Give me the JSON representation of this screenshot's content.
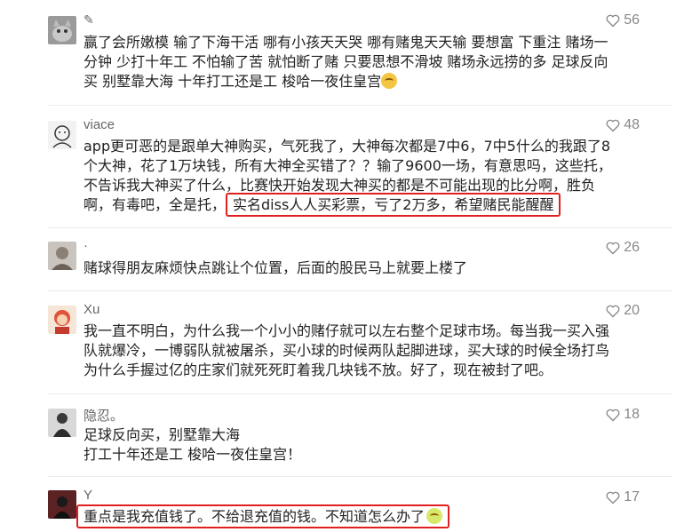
{
  "colors": {
    "highlight": "#e02020",
    "meta_text": "#888888",
    "body_text": "#222222"
  },
  "comments": [
    {
      "name": "",
      "likes": "56",
      "lines": [
        "赢了会所嫩模 输了下海干活 哪有小孩天天哭 哪有赌鬼天天输 要想富 下重注 赌场一",
        "分钟 少打十年工 不怕输了苦 就怕断了赌 只要思想不滑坡 赌场永远捞的多 足球反向",
        "买 别墅靠大海 十年打工还是工 梭哈一夜住皇宫"
      ],
      "avatar": "cat-avatar"
    },
    {
      "name": "viace",
      "likes": "48",
      "lines": [
        "app更可恶的是跟单大神购买，气死我了，大神每次都是7中6，7中5什么的我跟了8",
        "个大神，花了1万块钱，所有大神全买错了？？输了9600一场，有意思吗，这些托，",
        "不告诉我大神买了什么，比赛快开始发现大神买的都是不可能出现的比分啊，胜负",
        "啊，有毒吧，全是托，"
      ],
      "highlight": "实名diss人人买彩票，亏了2万多，希望赌民能醒醒",
      "avatar": "sketch-avatar"
    },
    {
      "name": "·",
      "likes": "26",
      "lines": [
        "赌球得朋友麻烦快点跳让个位置，后面的股民马上就要上楼了"
      ],
      "avatar": "portrait-avatar"
    },
    {
      "name": "Xu",
      "likes": "20",
      "lines": [
        "我一直不明白，为什么我一个小小的赌仔就可以左右整个足球市场。每当我一买入强",
        "队就爆冷，一博弱队就被屠杀，买小球的时候两队起脚进球，买大球的时候全场打鸟",
        "为什么手握过亿的庄家们就死死盯着我几块钱不放。好了，现在被封了吧。"
      ],
      "avatar": "cartoon-avatar"
    },
    {
      "name": "隐忍。",
      "likes": "18",
      "lines": [
        "足球反向买，别墅靠大海",
        "打工十年还是工 梭哈一夜住皇宫！"
      ],
      "avatar": "person-avatar"
    },
    {
      "name": "Y",
      "likes": "17",
      "lines": [],
      "highlight": "重点是我充值钱了。不给退充值的钱。不知道怎么办了",
      "avatar": "dark-avatar"
    }
  ]
}
